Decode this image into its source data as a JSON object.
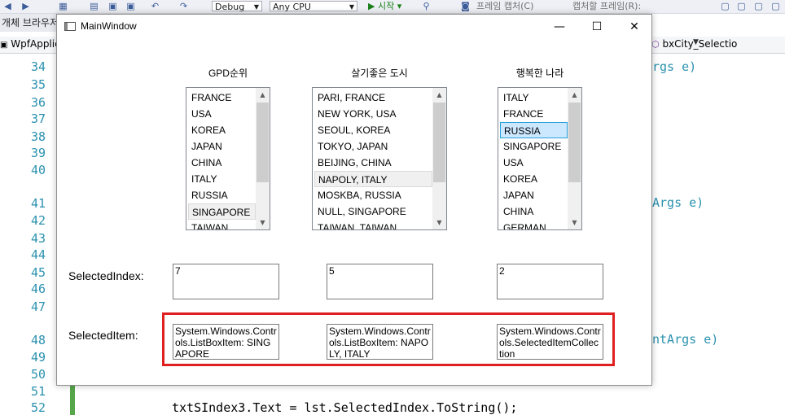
{
  "vs": {
    "toolbar": {
      "config": "Debug",
      "platform": "Any CPU",
      "start_label": "▶ 시작 ▾",
      "frame_capture": "프레임 캡처(C)",
      "capture_frame": "캡처할 프레임(R):"
    },
    "object_browser_tab": "개체 브라우저",
    "nav_project": "WpfApplic",
    "nav_member": "bxCity_Selectio",
    "line_numbers": [
      "34",
      "35",
      "36",
      "37",
      "38",
      "39",
      "40",
      "41",
      "42",
      "43",
      "44",
      "45",
      "46",
      "47",
      "48",
      "49",
      "50",
      "51",
      "52"
    ],
    "code": {
      "frag1": "rgs e)",
      "frag2": "Args e)",
      "frag3": "ntArgs e)",
      "last_line": "txtSIndex3.Text = lst.SelectedIndex.ToString();"
    }
  },
  "window": {
    "title": "MainWindow",
    "minimize_glyph": "—",
    "maximize_glyph": "☐",
    "close_glyph": "✕"
  },
  "lists": [
    {
      "header": "GPD순위",
      "items": [
        "FRANCE",
        "USA",
        "KOREA",
        "JAPAN",
        "CHINA",
        "ITALY",
        "RUSSIA",
        "SINGAPORE",
        "TAIWAN"
      ],
      "selected_index_display": "7"
    },
    {
      "header": "살기좋은 도시",
      "items": [
        "PARI, FRANCE",
        "NEW YORK, USA",
        "SEOUL, KOREA",
        "TOKYO, JAPAN",
        "BEIJING, CHINA",
        "NAPOLY, ITALY",
        "MOSKBA, RUSSIA",
        "NULL, SINGAPORE",
        "TAIWAN, TAIWAN"
      ],
      "selected_index_display": "5"
    },
    {
      "header": "행복한 나라",
      "items": [
        "ITALY",
        "FRANCE",
        "RUSSIA",
        "SINGAPORE",
        "USA",
        "KOREA",
        "JAPAN",
        "CHINA",
        "GERMAN"
      ],
      "selected_index_display": "2"
    }
  ],
  "labels": {
    "selected_index": "SelectedIndex:",
    "selected_item": "SelectedItem:"
  },
  "selected_items": [
    "System.Windows.Controls.ListBoxItem: SINGAPORE",
    "System.Windows.Controls.ListBoxItem: NAPOLY, ITALY",
    "System.Windows.Controls.SelectedItemCollection"
  ],
  "scrollbar": {
    "up_glyph": "▲",
    "down_glyph": "▼"
  }
}
